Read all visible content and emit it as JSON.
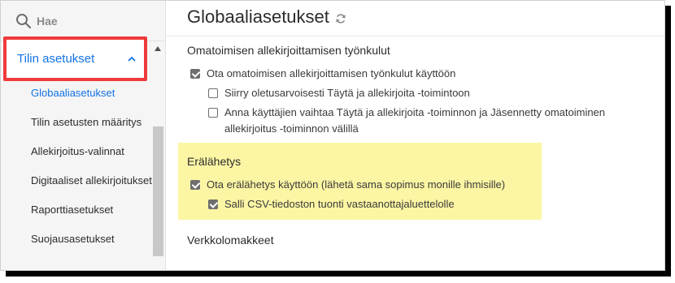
{
  "search": {
    "placeholder": "Hae",
    "icon": "search-icon"
  },
  "sidebar": {
    "section_label": "Tilin asetukset",
    "section_icon": "chevron-up-icon",
    "items": [
      {
        "label": "Globaaliasetukset",
        "active": true
      },
      {
        "label": "Tilin asetusten määritys",
        "active": false
      },
      {
        "label": "Allekirjoitus-valinnat",
        "active": false
      },
      {
        "label": "Digitaaliset allekirjoitukset",
        "active": false
      },
      {
        "label": "Raporttiasetukset",
        "active": false
      },
      {
        "label": "Suojausasetukset",
        "active": false
      }
    ]
  },
  "main": {
    "title": "Globaaliasetukset",
    "title_icon": "refresh-icon",
    "sections": [
      {
        "title": "Omatoimisen allekirjoittamisen työnkulut",
        "options": [
          {
            "label": "Ota omatoimisen allekirjoittamisen työnkulut käyttöön",
            "checked": true
          },
          {
            "label": "Siirry oletusarvoisesti Täytä ja allekirjoita -toimintoon",
            "checked": false
          },
          {
            "label": "Anna käyttäjien vaihtaa Täytä ja allekirjoita -toiminnon ja Jäsennetty omatoiminen allekirjoitus -toiminnon välillä",
            "checked": false
          }
        ]
      },
      {
        "title": "Erälähetys",
        "options": [
          {
            "label": "Ota erälähetys käyttöön (lähetä sama sopimus monille ihmisille)",
            "checked": true
          },
          {
            "label": "Salli CSV-tiedoston tuonti vastaanottajaluettelolle",
            "checked": true
          }
        ]
      },
      {
        "title": "Verkkolomakkeet"
      }
    ]
  },
  "colors": {
    "accent": "#1473e6",
    "callout_border": "#f0393a",
    "highlight": "#fcf6a4"
  }
}
